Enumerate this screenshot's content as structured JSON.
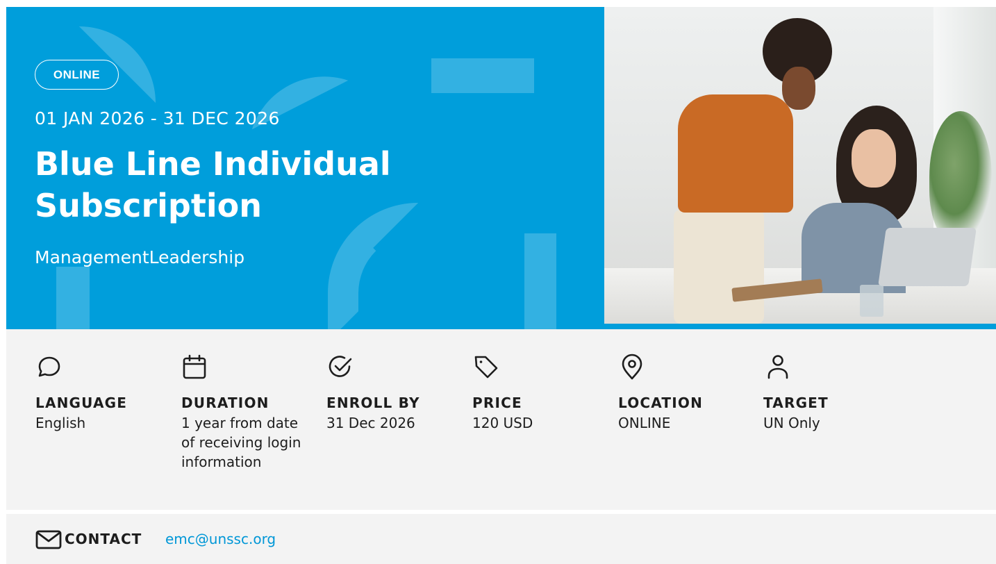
{
  "hero": {
    "badge": "ONLINE",
    "dates": "01 JAN 2026 - 31 DEC 2026",
    "title": "Blue Line Individual Subscription",
    "tags": "ManagementLeadership",
    "accent_color": "#009edb",
    "image_alt": "Two women smiling while working at a laptop in a bright office"
  },
  "details": [
    {
      "icon": "chat-bubble-icon",
      "label": "LANGUAGE",
      "value": "English"
    },
    {
      "icon": "calendar-icon",
      "label": "DURATION",
      "value": "1 year from date of receiving login information"
    },
    {
      "icon": "check-circle-icon",
      "label": "ENROLL BY",
      "value": "31 Dec 2026"
    },
    {
      "icon": "price-tag-icon",
      "label": "PRICE",
      "value": "120 USD"
    },
    {
      "icon": "location-pin-icon",
      "label": "LOCATION",
      "value": "ONLINE"
    },
    {
      "icon": "user-icon",
      "label": "TARGET",
      "value": "UN Only"
    }
  ],
  "contact": {
    "icon": "mail-icon",
    "label": "CONTACT",
    "email": "emc@unssc.org",
    "link_color": "#0097d7"
  }
}
